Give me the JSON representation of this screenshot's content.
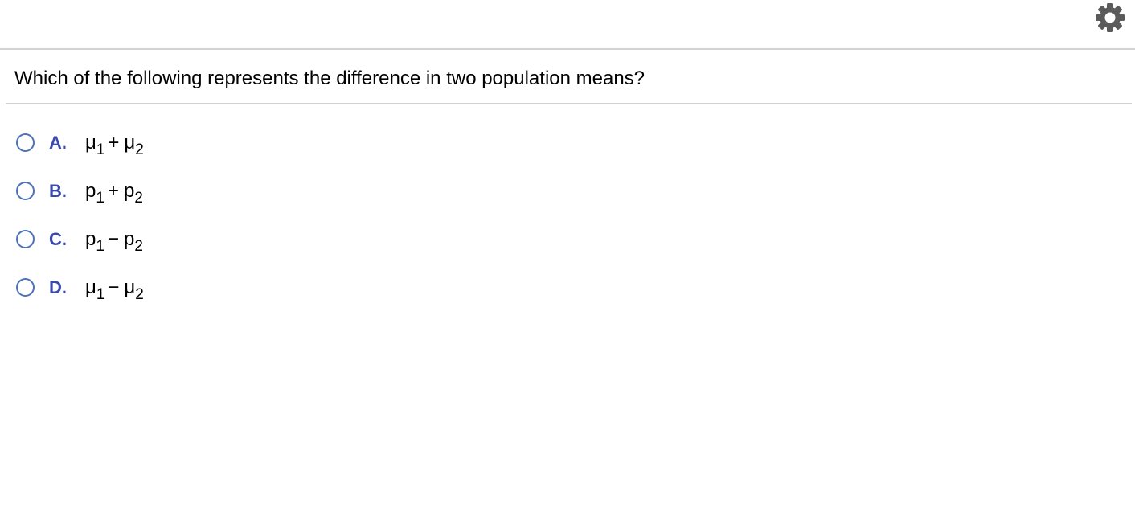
{
  "toolbar": {
    "settings_icon": "gear-icon"
  },
  "question": {
    "text": "Which of the following represents the difference in two population means?"
  },
  "options": [
    {
      "letter": "A.",
      "term1": "μ",
      "sub1": "1",
      "operator": "+",
      "term2": "μ",
      "sub2": "2"
    },
    {
      "letter": "B.",
      "term1": "p",
      "sub1": "1",
      "operator": "+",
      "term2": "p",
      "sub2": "2"
    },
    {
      "letter": "C.",
      "term1": "p",
      "sub1": "1",
      "operator": "−",
      "term2": "p",
      "sub2": "2"
    },
    {
      "letter": "D.",
      "term1": "μ",
      "sub1": "1",
      "operator": "−",
      "term2": "μ",
      "sub2": "2"
    }
  ],
  "colors": {
    "radio_border": "#4e72b9",
    "option_letter": "#3b49aa",
    "rule": "#d2d2d4",
    "gear": "#5b5b5b"
  }
}
